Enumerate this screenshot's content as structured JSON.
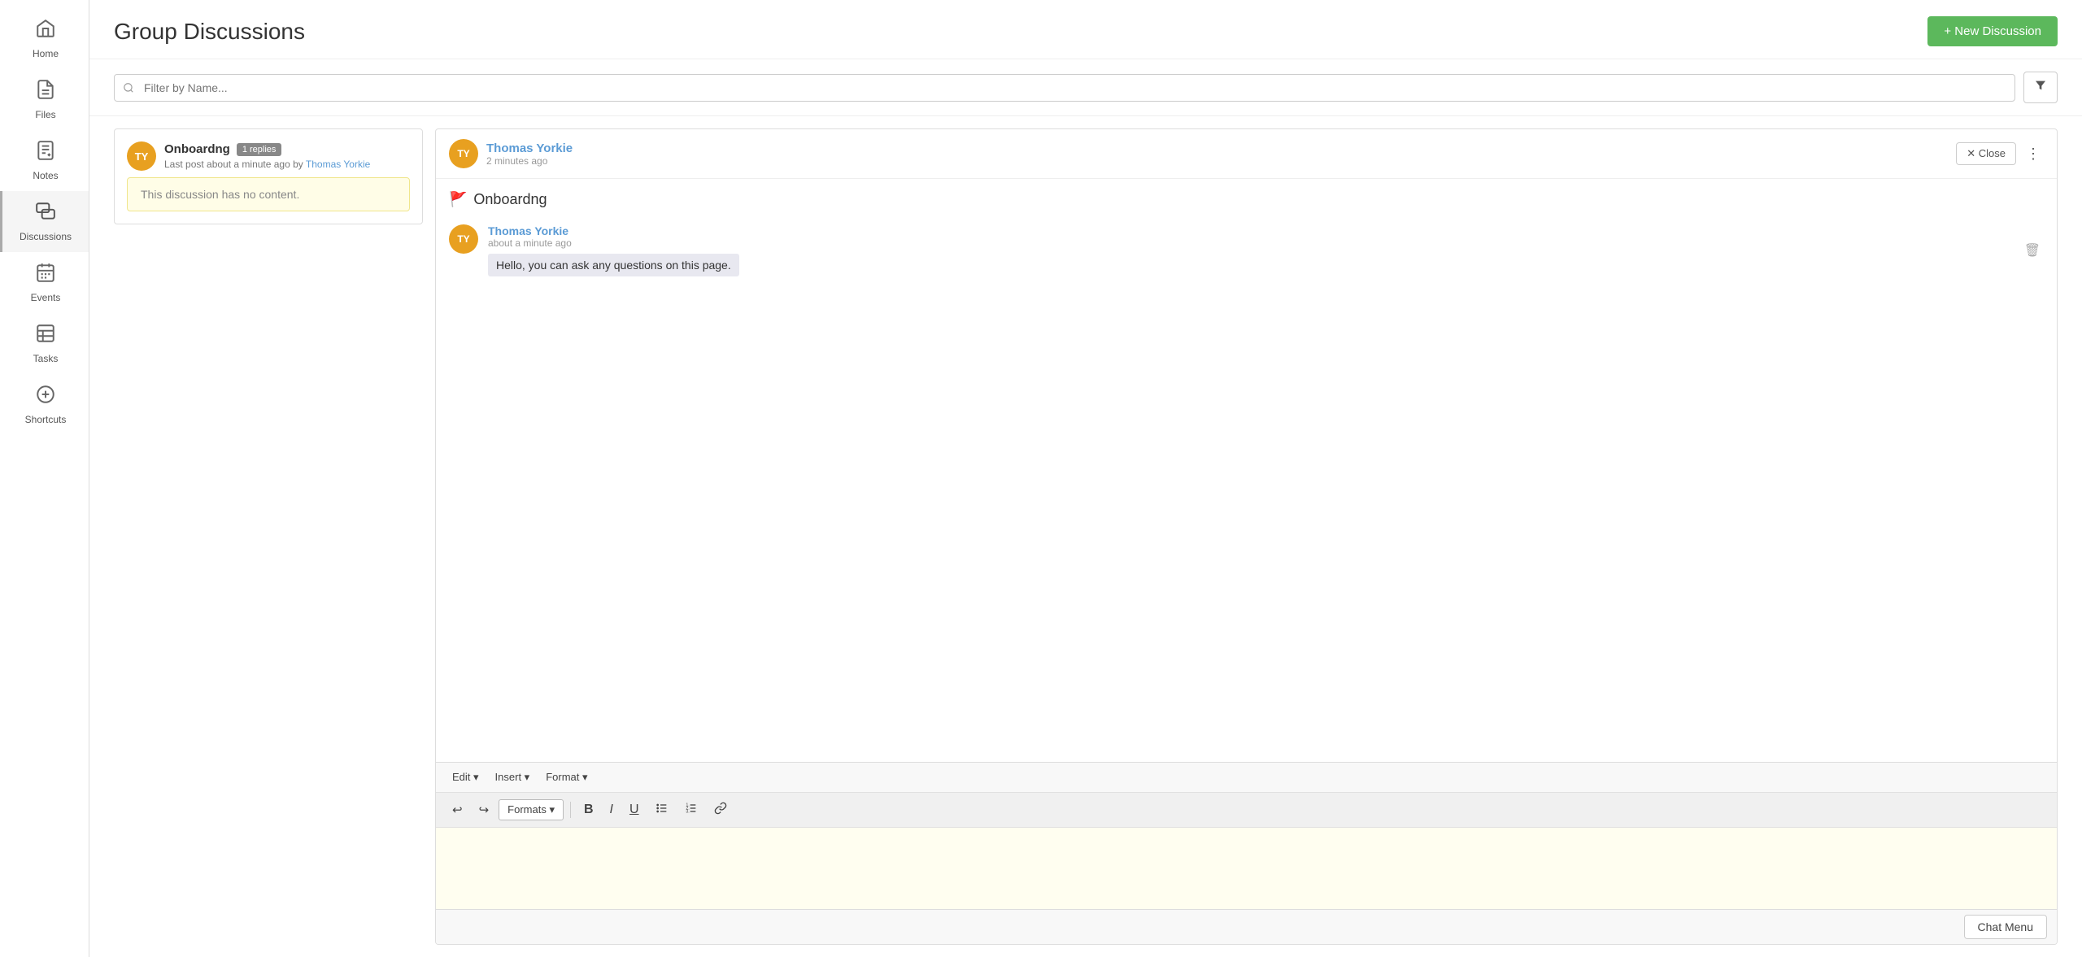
{
  "sidebar": {
    "items": [
      {
        "id": "home",
        "label": "Home",
        "icon": "🏠"
      },
      {
        "id": "files",
        "label": "Files",
        "icon": "📄"
      },
      {
        "id": "notes",
        "label": "Notes",
        "icon": "📝"
      },
      {
        "id": "discussions",
        "label": "Discussions",
        "icon": "💬",
        "active": true
      },
      {
        "id": "events",
        "label": "Events",
        "icon": "📅"
      },
      {
        "id": "tasks",
        "label": "Tasks",
        "icon": "📋"
      },
      {
        "id": "shortcuts",
        "label": "Shortcuts",
        "icon": "➕"
      }
    ]
  },
  "header": {
    "title": "Group Discussions",
    "new_discussion_label": "+ New Discussion"
  },
  "search": {
    "placeholder": "Filter by Name..."
  },
  "discussions": [
    {
      "id": 1,
      "avatar_initials": "TY",
      "title": "Onboardng",
      "replies_count": "1 replies",
      "last_post_meta": "Last post about a minute ago by",
      "last_post_author": "Thomas Yorkie",
      "no_content_message": "This discussion has no content."
    }
  ],
  "detail": {
    "avatar_initials": "TY",
    "author_name": "Thomas Yorkie",
    "time": "2 minutes ago",
    "close_label": "✕ Close",
    "topic_title": "Onboardng",
    "reply": {
      "avatar_initials": "TY",
      "author_name": "Thomas Yorkie",
      "time": "about a minute ago",
      "message": "Hello, you can ask any questions on this page."
    }
  },
  "editor": {
    "menu": {
      "edit_label": "Edit ▾",
      "insert_label": "Insert ▾",
      "format_label": "Format ▾"
    },
    "toolbar": {
      "formats_label": "Formats ▾",
      "bold_label": "B",
      "italic_label": "I",
      "underline_label": "U",
      "bullet_label": "☰",
      "numbered_label": "≡",
      "link_label": "🔗"
    }
  },
  "chat_menu": {
    "label": "Chat Menu"
  }
}
